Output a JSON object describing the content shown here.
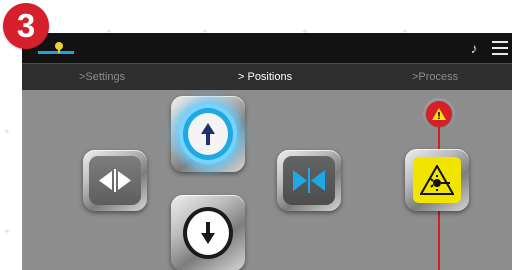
{
  "badge": {
    "number": "3"
  },
  "nav": [
    {
      "label": ">Settings"
    },
    {
      "label": "> Positions"
    },
    {
      "label": ">Process"
    }
  ],
  "colors": {
    "accent_blue": "#1fa3d8",
    "warning_red": "#d71f2a",
    "laser_yellow": "#f1e500"
  },
  "icons": {
    "topbar_left": "location-pin-icon",
    "topbar_bell": "bell-icon",
    "topbar_menu": "menu-icon",
    "left_button": "arrows-outward-icon",
    "right_button": "arrows-inward-icon",
    "up_button": "arrow-up-icon",
    "down_button": "arrow-down-icon",
    "warning": "warning-icon",
    "laser": "laser-warning-icon"
  }
}
